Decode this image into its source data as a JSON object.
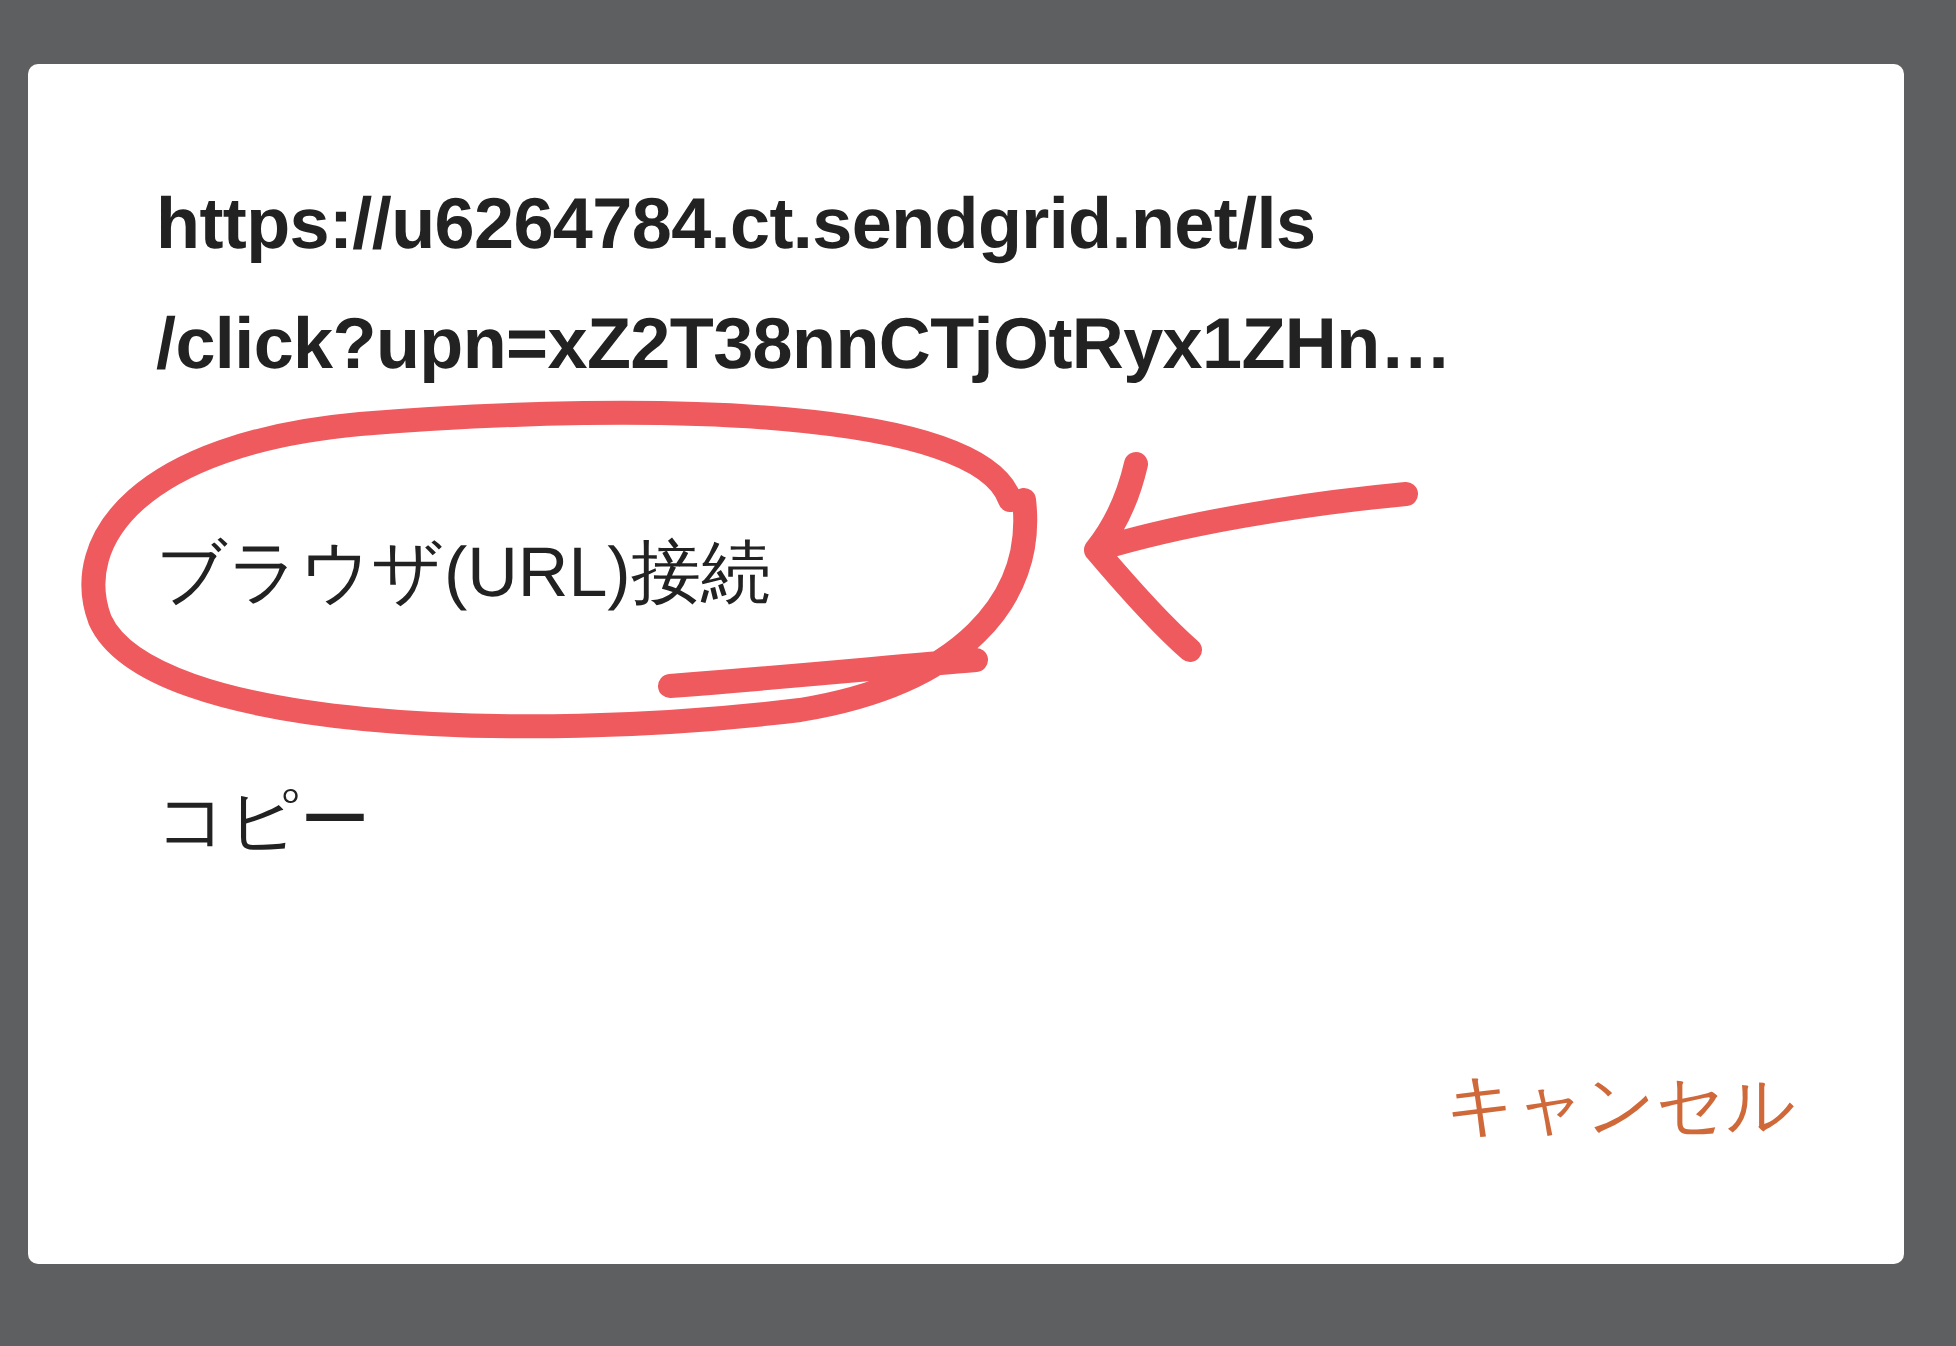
{
  "dialog": {
    "title_lines": [
      "https://u6264784.ct.sendgrid.net/ls",
      "/click?upn=xZ2T38nnCTjOtRyx1ZHn…"
    ],
    "items": [
      {
        "label": "ブラウザ(URL)接続",
        "annotated": true
      },
      {
        "label": "コピー",
        "annotated": false
      }
    ],
    "cancel_button": "キャンセル"
  }
}
